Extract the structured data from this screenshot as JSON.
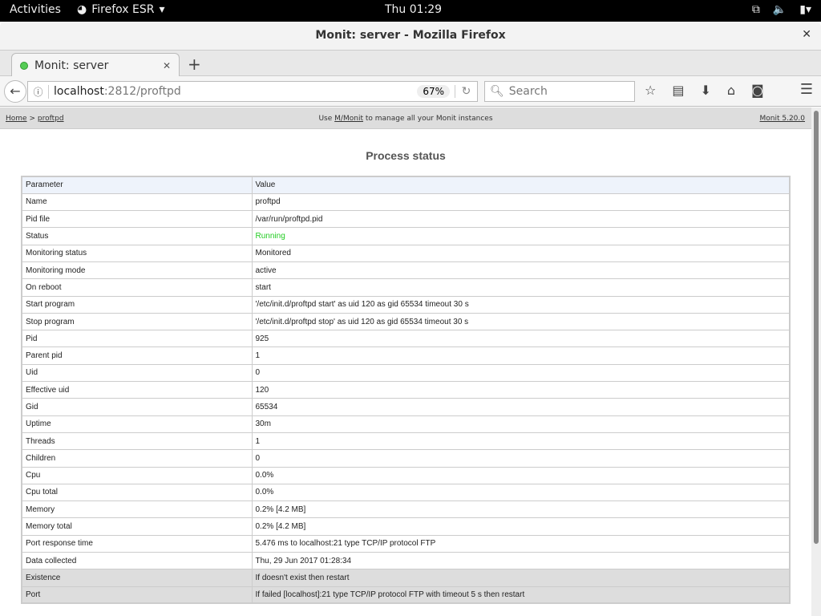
{
  "topbar": {
    "activities": "Activities",
    "app": "Firefox ESR",
    "clock": "Thu 01:29"
  },
  "window": {
    "title": "Monit: server - Mozilla Firefox"
  },
  "tab": {
    "label": "Monit: server"
  },
  "nav": {
    "host": "localhost",
    "path": ":2812/proftpd",
    "zoom": "67%",
    "search_placeholder": "Search"
  },
  "page": {
    "breadcrumb_home": "Home",
    "breadcrumb_sep": ">",
    "breadcrumb_current": "proftpd",
    "banner_pre": "Use",
    "banner_link": "M/Monit",
    "banner_post": "to manage all your Monit instances",
    "version": "Monit 5.20.0",
    "title": "Process status",
    "columns": [
      "Parameter",
      "Value"
    ],
    "status_color": "#22cc22",
    "rows": [
      [
        "Name",
        "proftpd"
      ],
      [
        "Pid file",
        "/var/run/proftpd.pid"
      ],
      [
        "Status",
        "Running"
      ],
      [
        "Monitoring status",
        "Monitored"
      ],
      [
        "Monitoring mode",
        "active"
      ],
      [
        "On reboot",
        "start"
      ],
      [
        "Start program",
        "'/etc/init.d/proftpd start' as uid 120 as gid 65534 timeout 30 s"
      ],
      [
        "Stop program",
        "'/etc/init.d/proftpd stop' as uid 120 as gid 65534 timeout 30 s"
      ],
      [
        "Pid",
        "925"
      ],
      [
        "Parent pid",
        "1"
      ],
      [
        "Uid",
        "0"
      ],
      [
        "Effective uid",
        "120"
      ],
      [
        "Gid",
        "65534"
      ],
      [
        "Uptime",
        "30m"
      ],
      [
        "Threads",
        "1"
      ],
      [
        "Children",
        "0"
      ],
      [
        "Cpu",
        "0.0%"
      ],
      [
        "Cpu total",
        "0.0%"
      ],
      [
        "Memory",
        "0.2% [4.2 MB]"
      ],
      [
        "Memory total",
        "0.2% [4.2 MB]"
      ],
      [
        "Port response time",
        "5.476 ms to localhost:21 type TCP/IP protocol FTP"
      ],
      [
        "Data collected",
        "Thu, 29 Jun 2017 01:28:34"
      ]
    ],
    "rule_rows": [
      [
        "Existence",
        "If doesn't exist then restart"
      ],
      [
        "Port",
        "If failed [localhost]:21 type TCP/IP protocol FTP with timeout 5 s then restart"
      ]
    ]
  }
}
